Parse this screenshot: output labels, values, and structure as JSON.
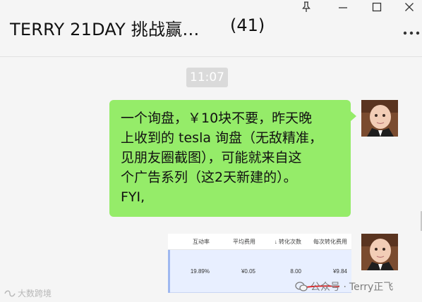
{
  "window": {
    "title": "TERRY 21DAY 挑战赢…",
    "member_count": "(41)",
    "pin_icon": "pin-icon",
    "minimize_icon": "minimize-icon",
    "maximize_icon": "maximize-icon",
    "close_icon": "close-icon",
    "more_icon": "more-icon"
  },
  "chat": {
    "timestamp": "11:07",
    "message_lines": [
      "一个询盘，￥10块不要，昨天晚",
      "上收到的 tesla 询盘（无敌精准，",
      "见朋友圈截图），可能就来自这",
      "个广告系列（这2天新建的）。",
      "FYI,"
    ],
    "bubble_color": "#95ec69"
  },
  "image_message": {
    "headers": [
      "互动率",
      "平均费用",
      "↓ 转化次数",
      "每次转化费用"
    ],
    "row": [
      "19.89%",
      "¥0.05",
      "8.00",
      "¥9.84"
    ]
  },
  "watermarks": {
    "left": "大数跨境",
    "right_prefix": "公众号 · ",
    "right_name": "Terry正飞"
  }
}
